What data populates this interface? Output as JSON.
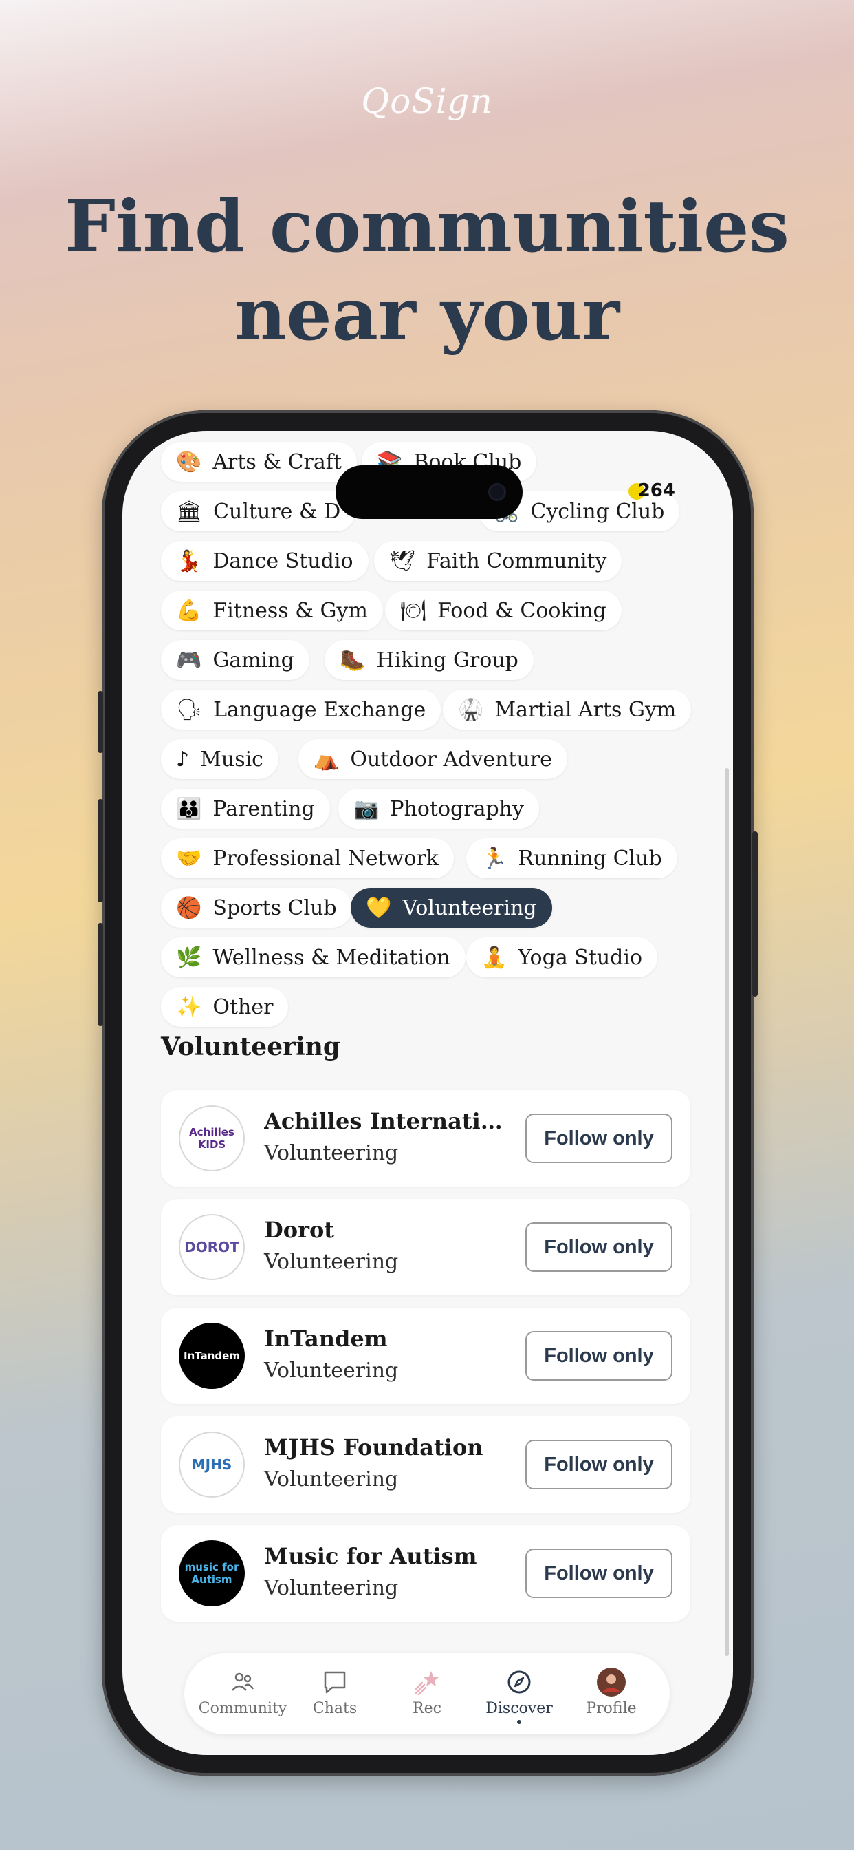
{
  "brand": "QoSign",
  "headline": {
    "line1": "Find communities",
    "line2": "near your"
  },
  "status": {
    "time": "264"
  },
  "categories": [
    {
      "emoji": "🎨",
      "label": "Arts & Craft"
    },
    {
      "emoji": "📚",
      "label": "Book Club"
    },
    {
      "emoji": "🏛",
      "label": "Culture & D"
    },
    {
      "emoji": "🚴",
      "label": "Cycling Club"
    },
    {
      "emoji": "💃",
      "label": "Dance Studio"
    },
    {
      "emoji": "🕊",
      "label": "Faith Community"
    },
    {
      "emoji": "💪",
      "label": "Fitness & Gym"
    },
    {
      "emoji": "🍽",
      "label": "Food & Cooking"
    },
    {
      "emoji": "🎮",
      "label": "Gaming"
    },
    {
      "emoji": "🥾",
      "label": "Hiking Group"
    },
    {
      "emoji": "🗣",
      "label": "Language Exchange"
    },
    {
      "emoji": "🥋",
      "label": "Martial Arts Gym"
    },
    {
      "emoji": "♪",
      "label": "Music"
    },
    {
      "emoji": "⛺",
      "label": "Outdoor Adventure"
    },
    {
      "emoji": "👪",
      "label": "Parenting"
    },
    {
      "emoji": "📷",
      "label": "Photography"
    },
    {
      "emoji": "🤝",
      "label": "Professional Network"
    },
    {
      "emoji": "🏃",
      "label": "Running Club"
    },
    {
      "emoji": "🏀",
      "label": "Sports Club"
    },
    {
      "emoji": "💛",
      "label": "Volunteering"
    },
    {
      "emoji": "🌿",
      "label": "Wellness & Meditation"
    },
    {
      "emoji": "🧘",
      "label": "Yoga Studio"
    },
    {
      "emoji": "✨",
      "label": "Other"
    }
  ],
  "selected_category": "Volunteering",
  "section_title": "Volunteering",
  "communities": [
    {
      "name": "Achilles Internatio...",
      "category": "Volunteering",
      "action": "Follow only",
      "logo_text": "Achilles KIDS",
      "logo_bg": "#ffffff",
      "logo_fg": "#5a2a8a"
    },
    {
      "name": "Dorot",
      "category": "Volunteering",
      "action": "Follow only",
      "logo_text": "DOROT",
      "logo_bg": "#ffffff",
      "logo_fg": "#5b4a9e"
    },
    {
      "name": "InTandem",
      "category": "Volunteering",
      "action": "Follow only",
      "logo_text": "InTandem",
      "logo_bg": "#000000",
      "logo_fg": "#ffffff"
    },
    {
      "name": "MJHS Foundation",
      "category": "Volunteering",
      "action": "Follow only",
      "logo_text": "MJHS",
      "logo_bg": "#ffffff",
      "logo_fg": "#2a6fb5"
    },
    {
      "name": "Music for Autism",
      "category": "Volunteering",
      "action": "Follow only",
      "logo_text": "music for Autism",
      "logo_bg": "#000000",
      "logo_fg": "#4ab4e8"
    }
  ],
  "tabs": [
    {
      "label": "Community",
      "icon": "people-icon"
    },
    {
      "label": "Chats",
      "icon": "chat-bubble-icon"
    },
    {
      "label": "Rec",
      "icon": "shooting-star-icon"
    },
    {
      "label": "Discover",
      "icon": "compass-icon"
    },
    {
      "label": "Profile",
      "icon": "avatar-icon"
    }
  ],
  "active_tab": "Discover",
  "colors": {
    "accent": "#2b3a4d",
    "chip_bg": "#ffffff",
    "screen_bg": "#f7f7f7"
  }
}
